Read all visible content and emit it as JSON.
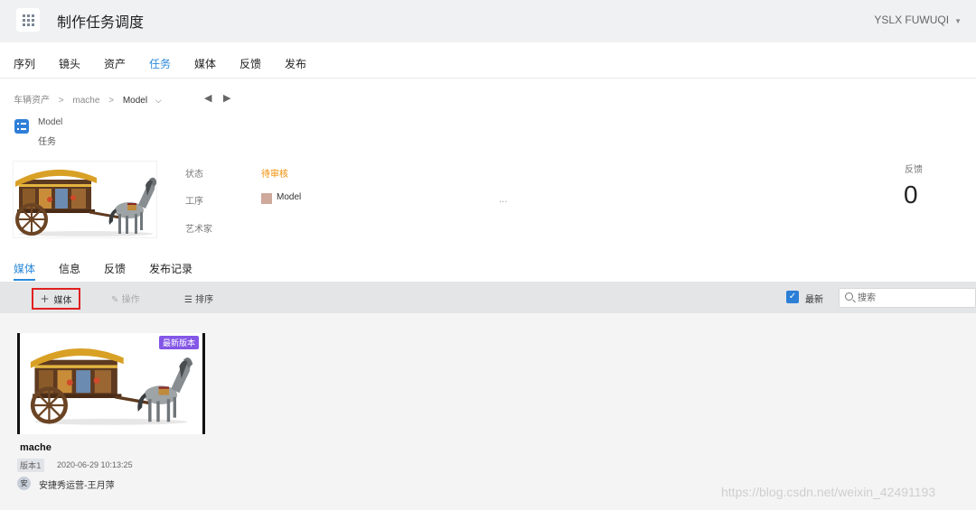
{
  "header": {
    "title": "制作任务调度",
    "user": "YSLX FUWUQI"
  },
  "main_tabs": [
    {
      "label": "序列"
    },
    {
      "label": "镜头"
    },
    {
      "label": "资产"
    },
    {
      "label": "任务",
      "active": true
    },
    {
      "label": "媒体"
    },
    {
      "label": "反馈"
    },
    {
      "label": "发布"
    }
  ],
  "breadcrumb": {
    "items": [
      "车辆资产",
      "mache",
      "Model"
    ],
    "separator": ">"
  },
  "entity": {
    "name": "Model",
    "type": "任务"
  },
  "info": {
    "status_label": "状态",
    "status_value": "待审核",
    "step_label": "工序",
    "step_value": "Model",
    "artist_label": "艺术家",
    "ellipsis": "...",
    "feedback_label": "反馈",
    "feedback_count": "0"
  },
  "sub_tabs": [
    {
      "label": "媒体",
      "active": true
    },
    {
      "label": "信息"
    },
    {
      "label": "反馈"
    },
    {
      "label": "发布记录"
    }
  ],
  "toolbar": {
    "add_media": "媒体",
    "operate": "操作",
    "sort": "排序",
    "latest": "最新",
    "latest_checked": true,
    "search_placeholder": "搜索"
  },
  "media_card": {
    "badge": "最新版本",
    "name": "mache",
    "version": "版本1",
    "time": "2020-06-29 10:13:25",
    "avatar_char": "安",
    "author": "安捷秀运营-王月萍"
  },
  "watermark": "https://blog.csdn.net/weixin_42491193",
  "colors": {
    "accent": "#2b8ad9",
    "status": "#f08c00",
    "badge": "#8456e6",
    "highlight_border": "#e02020",
    "step_swatch": "#cea99c"
  }
}
